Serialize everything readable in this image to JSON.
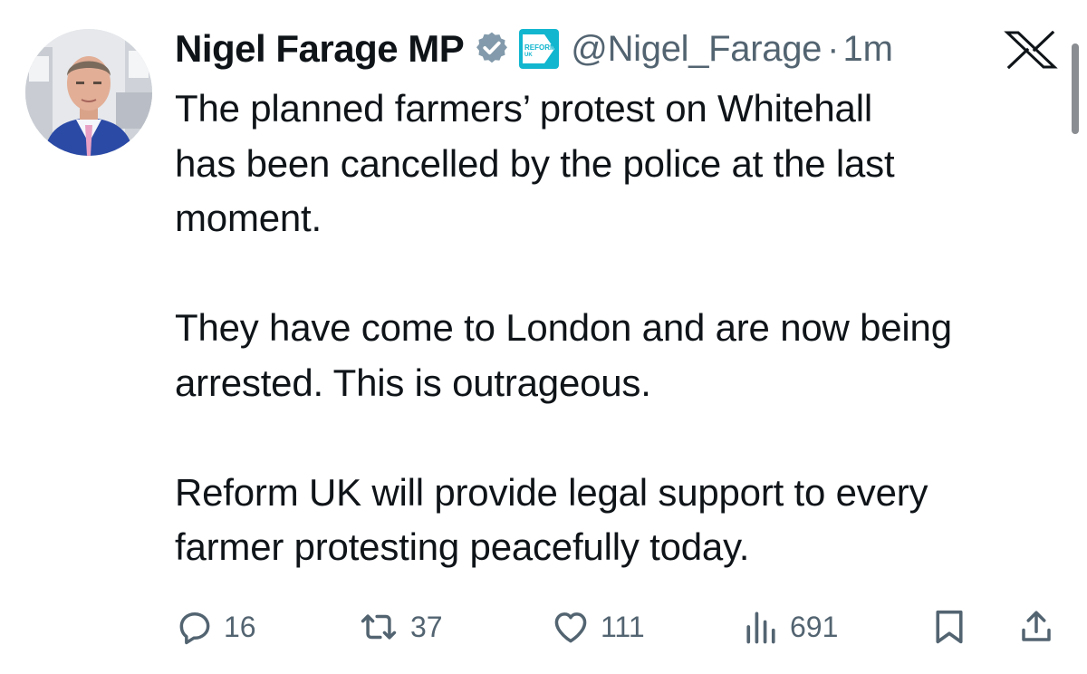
{
  "author": {
    "name": "Nigel Farage MP",
    "handle": "@Nigel_Farage",
    "separator": "·",
    "time": "1m",
    "affiliate_badge_text_line1": "REFORM",
    "affiliate_badge_text_line2": "UK"
  },
  "tweet": {
    "paragraphs": [
      [
        "The planned farmers’ protest on Whitehall",
        "has been cancelled by the police at the last",
        "moment."
      ],
      [
        "They have come to London and are now being",
        "arrested. This is outrageous."
      ],
      [
        "Reform UK will provide legal support to every",
        "farmer protesting peacefully today."
      ]
    ]
  },
  "actions": {
    "replies": "16",
    "reposts": "37",
    "likes": "111",
    "views": "691"
  },
  "icons": {
    "verified": "verified-badge-icon",
    "affiliate": "reform-uk-affiliate-icon",
    "platform": "x-logo-icon",
    "reply": "reply-icon",
    "repost": "repost-icon",
    "like": "heart-icon",
    "views": "views-icon",
    "bookmark": "bookmark-icon",
    "share": "share-icon"
  },
  "colors": {
    "text": "#0f1419",
    "secondary": "#536471",
    "verified": "#829aab",
    "reform": "#12b6cf"
  }
}
